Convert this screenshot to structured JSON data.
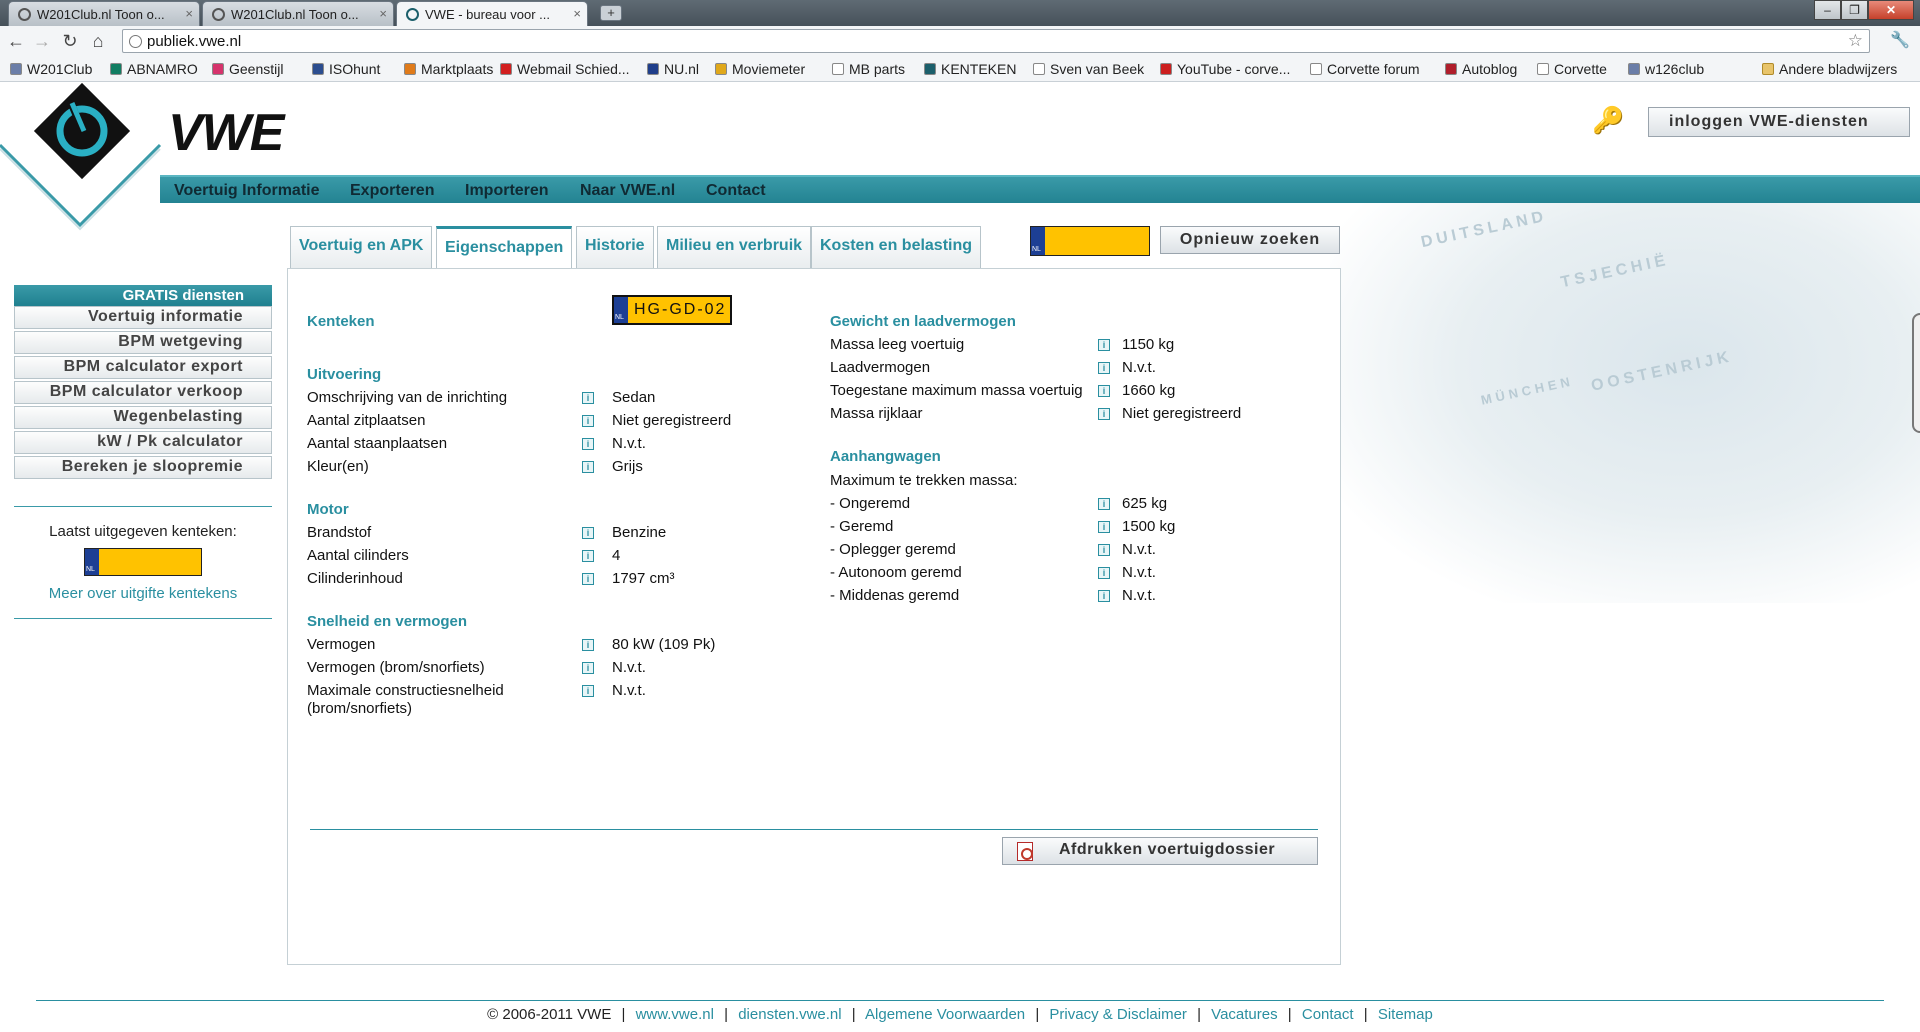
{
  "browser": {
    "tabs": [
      {
        "title": "W201Club.nl Toon o..."
      },
      {
        "title": "W201Club.nl Toon o..."
      },
      {
        "title": "VWE - bureau voor ..."
      }
    ],
    "new_tab": "+",
    "url": "publiek.vwe.nl",
    "bookmarks": [
      {
        "label": "W201Club",
        "color": "#6b7ea8"
      },
      {
        "label": "ABNAMRO",
        "color": "#117d62"
      },
      {
        "label": "Geenstijl",
        "color": "#d6336c"
      },
      {
        "label": "ISOhunt",
        "color": "#2b4d8f"
      },
      {
        "label": "Marktplaats",
        "color": "#e07b1a"
      },
      {
        "label": "Webmail Schied...",
        "color": "#d21f1f"
      },
      {
        "label": "NU.nl",
        "color": "#1f3e8a"
      },
      {
        "label": "Moviemeter",
        "color": "#e0a81a"
      },
      {
        "label": "MB parts",
        "color": "#ffffff"
      },
      {
        "label": "KENTEKEN",
        "color": "#1b5f6b"
      },
      {
        "label": "Sven van Beek",
        "color": "#ffffff"
      },
      {
        "label": "YouTube - corve...",
        "color": "#cc1f1f"
      },
      {
        "label": "Corvette forum",
        "color": "#ffffff"
      },
      {
        "label": "Autoblog",
        "color": "#b01e2b"
      },
      {
        "label": "Corvette",
        "color": "#ffffff"
      },
      {
        "label": "w126club",
        "color": "#6b7ea8"
      }
    ],
    "other_bookmarks": "Andere bladwijzers"
  },
  "site": {
    "brand": "VWE",
    "login": "inloggen VWE-diensten",
    "accent": "#2a8fa0",
    "nav": [
      "Voertuig Informatie",
      "Exporteren",
      "Importeren",
      "Naar VWE.nl",
      "Contact"
    ]
  },
  "sidebar": {
    "header": "GRATIS diensten",
    "items": [
      "Voertuig informatie",
      "BPM wetgeving",
      "BPM calculator export",
      "BPM calculator verkoop",
      "Wegenbelasting",
      "kW / Pk calculator",
      "Bereken je sloopremie"
    ],
    "last_issued_label": "Laatst uitgegeven kenteken:",
    "more_link": "Meer over uitgifte kentekens"
  },
  "content_tabs": [
    "Voertuig en APK",
    "Eigenschappen",
    "Historie",
    "Milieu en verbruik",
    "Kosten en belasting"
  ],
  "active_tab": "Eigenschappen",
  "search_again": "Opnieuw zoeken",
  "plate_country": "NL",
  "vehicle": {
    "kenteken_label": "Kenteken",
    "kenteken": "HG-GD-02",
    "uitvoering": {
      "title": "Uitvoering",
      "rows": [
        {
          "label": "Omschrijving van de inrichting",
          "value": "Sedan"
        },
        {
          "label": "Aantal zitplaatsen",
          "value": "Niet geregistreerd"
        },
        {
          "label": "Aantal staanplaatsen",
          "value": "N.v.t."
        },
        {
          "label": "Kleur(en)",
          "value": "Grijs"
        }
      ]
    },
    "motor": {
      "title": "Motor",
      "rows": [
        {
          "label": "Brandstof",
          "value": "Benzine"
        },
        {
          "label": "Aantal cilinders",
          "value": "4"
        },
        {
          "label": "Cilinderinhoud",
          "value": "1797 cm³"
        }
      ]
    },
    "snelheid": {
      "title": "Snelheid en vermogen",
      "rows": [
        {
          "label": "Vermogen",
          "value": "80 kW (109 Pk)"
        },
        {
          "label": "Vermogen (brom/snorfiets)",
          "value": "N.v.t."
        },
        {
          "label": "Maximale constructiesnelheid",
          "label2": "(brom/snorfiets)",
          "value": "N.v.t."
        }
      ]
    },
    "gewicht": {
      "title": "Gewicht en laadvermogen",
      "rows": [
        {
          "label": "Massa leeg voertuig",
          "value": "1150 kg"
        },
        {
          "label": "Laadvermogen",
          "value": "N.v.t."
        },
        {
          "label": "Toegestane maximum massa voertuig",
          "value": "1660 kg"
        },
        {
          "label": "Massa rijklaar",
          "value": "Niet geregistreerd"
        }
      ]
    },
    "aanhangwagen": {
      "title": "Aanhangwagen",
      "intro": "Maximum te trekken massa:",
      "rows": [
        {
          "label": "- Ongeremd",
          "value": "625 kg"
        },
        {
          "label": "- Geremd",
          "value": "1500 kg"
        },
        {
          "label": "- Oplegger geremd",
          "value": "N.v.t."
        },
        {
          "label": "- Autonoom geremd",
          "value": "N.v.t."
        },
        {
          "label": "- Middenas geremd",
          "value": "N.v.t."
        }
      ]
    }
  },
  "print_button": "Afdrukken voertuigdossier",
  "map_words": [
    "DUITSLAND",
    "TSJECHIË",
    "OOSTENRIJK",
    "MÜNCHEN"
  ],
  "footer": {
    "copyright": "© 2006-2011 VWE",
    "links": [
      "www.vwe.nl",
      "diensten.vwe.nl",
      "Algemene Voorwaarden",
      "Privacy & Disclaimer",
      "Vacatures",
      "Contact",
      "Sitemap"
    ]
  }
}
